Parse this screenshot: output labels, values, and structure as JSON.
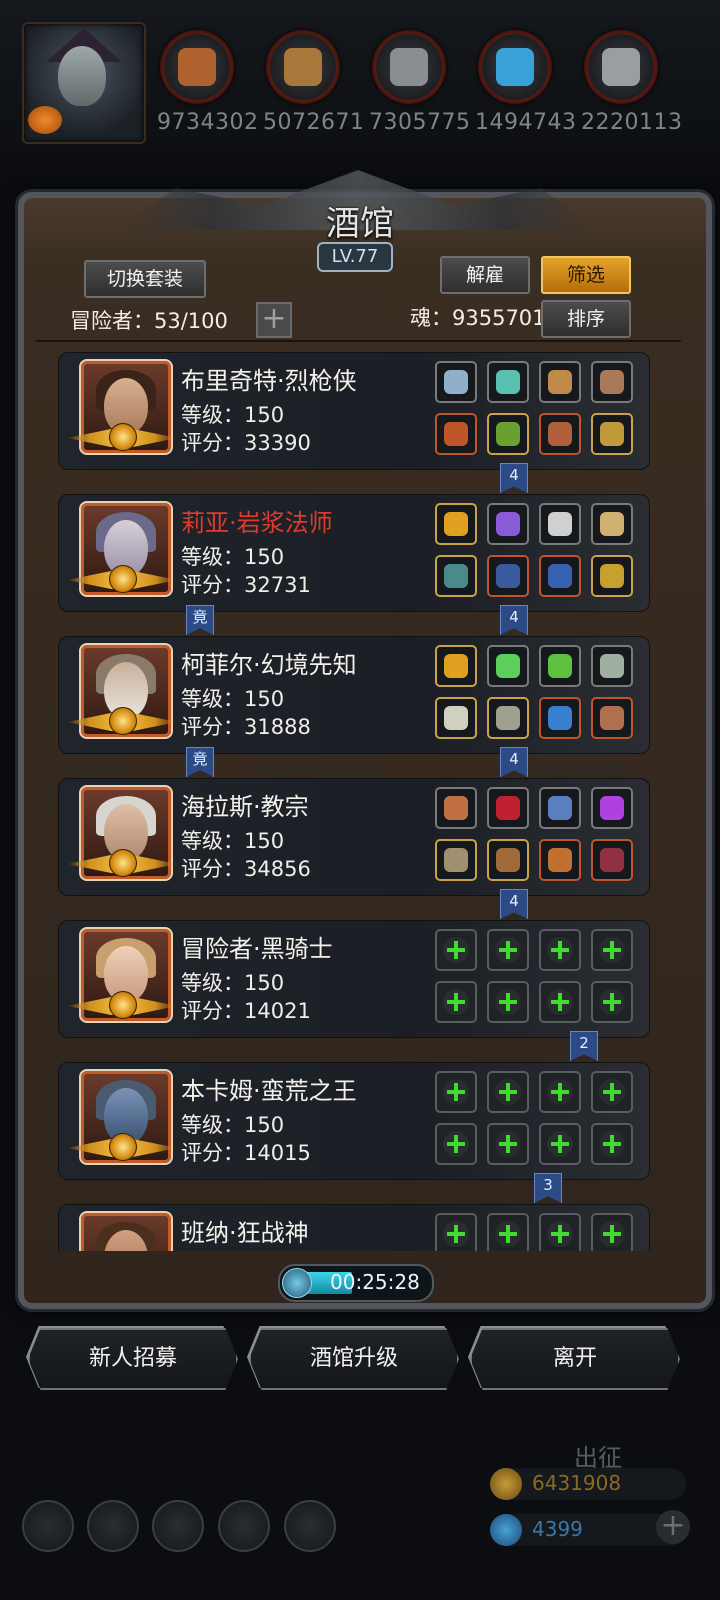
{
  "resources": [
    {
      "icon": "ore-icon",
      "value": "9734302",
      "color": "#b0622e"
    },
    {
      "icon": "wood-icon",
      "value": "5072671",
      "color": "#a8773a"
    },
    {
      "icon": "iron-icon",
      "value": "7305775",
      "color": "#8a8d92"
    },
    {
      "icon": "crystal-icon",
      "value": "1494743",
      "color": "#3aa0d8"
    },
    {
      "icon": "metal-icon",
      "value": "2220113",
      "color": "#9a9da2"
    }
  ],
  "tavern": {
    "title": "酒馆",
    "level": "LV.77",
    "switch_outfit": "切换套装",
    "dismiss": "解雇",
    "filter": "筛选",
    "sort": "排序",
    "adventurers": "冒险者：53/100",
    "soul": "魂：9355701"
  },
  "heroes": [
    {
      "name": "布里奇特·烈枪侠",
      "level": "等级：150",
      "score": "评分：33390",
      "red": false,
      "gear": [
        "#8fb0c8",
        "#5ac0b0",
        "#c08a4a",
        "#a87a5a",
        "#c0552a",
        "#6aa030",
        "#b0603a",
        "#c09a3a"
      ]
    },
    {
      "name": "莉亚·岩浆法师",
      "level": "等级：150",
      "score": "评分：32731",
      "red": true,
      "gear": [
        "#e0a020",
        "#8a5ad8",
        "#d0d0d0",
        "#d0b070",
        "#4a8a8a",
        "#3a5aa0",
        "#3a60b0",
        "#c8a030"
      ]
    },
    {
      "name": "柯菲尔·幻境先知",
      "level": "等级：150",
      "score": "评分：31888",
      "red": false,
      "gear": [
        "#e0a020",
        "#5ad05a",
        "#60c040",
        "#a0b0a0",
        "#d0d0c0",
        "#a0a090",
        "#3a80d0",
        "#b07050"
      ]
    },
    {
      "name": "海拉斯·教宗",
      "level": "等级：150",
      "score": "评分：34856",
      "red": false,
      "gear": [
        "#c07040",
        "#c02030",
        "#5a80c0",
        "#b040e0",
        "#a09070",
        "#a06a3a",
        "#c07030",
        "#903040"
      ]
    },
    {
      "name": "冒险者·黑骑士",
      "level": "等级：150",
      "score": "评分：14021",
      "red": false,
      "gear": []
    },
    {
      "name": "本卡姆·蛮荒之王",
      "level": "等级：150",
      "score": "评分：14015",
      "red": false,
      "gear": []
    },
    {
      "name": "班纳·狂战神",
      "level": "",
      "score": "",
      "red": false,
      "gear": []
    }
  ],
  "flags": {
    "row1": "4",
    "row2_left": "竟",
    "row2_right": "4",
    "row3_left": "竟",
    "row3_right": "4",
    "row4": "4",
    "row5": "2",
    "row6": "3"
  },
  "timer": "00:25:28",
  "actions": {
    "recruit": "新人招募",
    "upgrade": "酒馆升级",
    "leave": "离开"
  },
  "expedition": "出征",
  "gold": "6431908",
  "gems": "4399"
}
